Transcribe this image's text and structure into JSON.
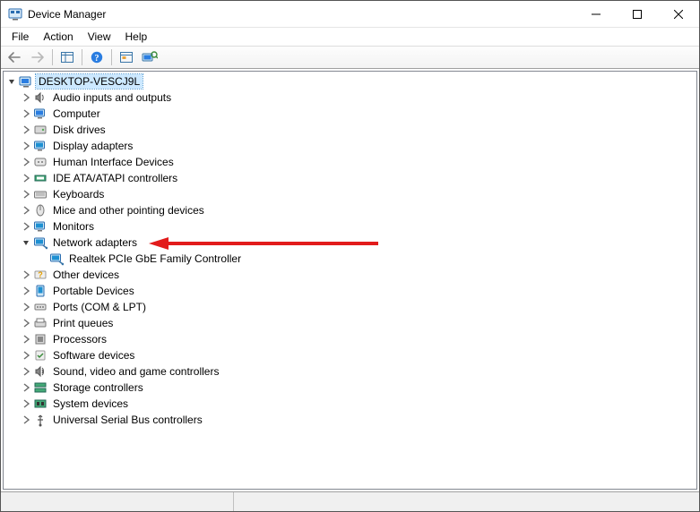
{
  "window": {
    "title": "Device Manager"
  },
  "menu": {
    "file": "File",
    "action": "Action",
    "view": "View",
    "help": "Help"
  },
  "tree": {
    "root": "DESKTOP-VESCJ9L",
    "items": [
      {
        "label": "Audio inputs and outputs",
        "icon": "speaker"
      },
      {
        "label": "Computer",
        "icon": "computer"
      },
      {
        "label": "Disk drives",
        "icon": "disk"
      },
      {
        "label": "Display adapters",
        "icon": "display"
      },
      {
        "label": "Human Interface Devices",
        "icon": "hid"
      },
      {
        "label": "IDE ATA/ATAPI controllers",
        "icon": "ide"
      },
      {
        "label": "Keyboards",
        "icon": "keyboard"
      },
      {
        "label": "Mice and other pointing devices",
        "icon": "mouse"
      },
      {
        "label": "Monitors",
        "icon": "monitor"
      },
      {
        "label": "Network adapters",
        "icon": "network",
        "expanded": true,
        "children": [
          {
            "label": "Realtek PCIe GbE Family Controller",
            "icon": "network"
          }
        ]
      },
      {
        "label": "Other devices",
        "icon": "other"
      },
      {
        "label": "Portable Devices",
        "icon": "portable"
      },
      {
        "label": "Ports (COM & LPT)",
        "icon": "port"
      },
      {
        "label": "Print queues",
        "icon": "printer"
      },
      {
        "label": "Processors",
        "icon": "cpu"
      },
      {
        "label": "Software devices",
        "icon": "software"
      },
      {
        "label": "Sound, video and game controllers",
        "icon": "sound"
      },
      {
        "label": "Storage controllers",
        "icon": "storage"
      },
      {
        "label": "System devices",
        "icon": "system"
      },
      {
        "label": "Universal Serial Bus controllers",
        "icon": "usb"
      }
    ]
  }
}
